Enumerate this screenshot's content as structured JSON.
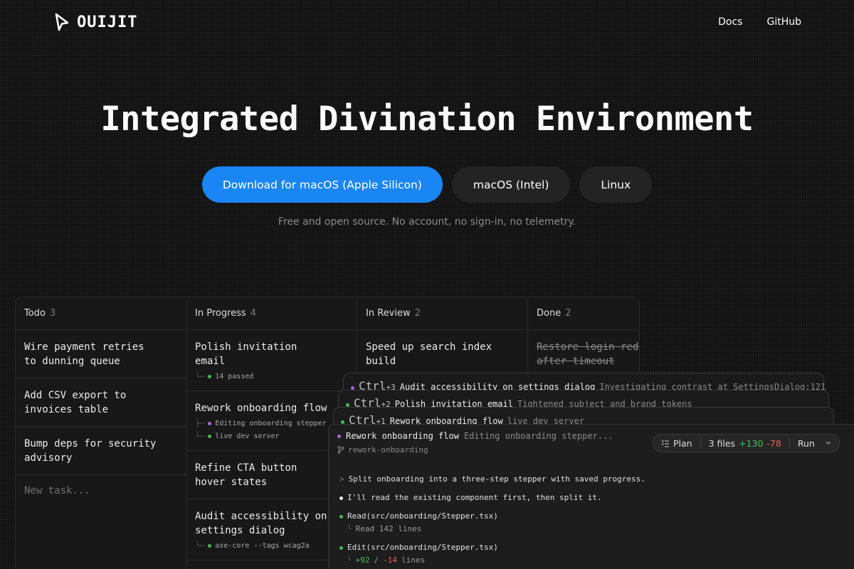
{
  "header": {
    "logo_text": "OUIJIT",
    "nav": [
      "Docs",
      "GitHub"
    ]
  },
  "hero": {
    "title": "Integrated Divination Environment",
    "buttons": {
      "primary": "Download for macOS (Apple Silicon)",
      "intel": "macOS (Intel)",
      "linux": "Linux"
    },
    "subtitle": "Free and open source. No account, no sign-in, no telemetry."
  },
  "board": {
    "columns": [
      {
        "name": "Todo",
        "count": "3"
      },
      {
        "name": "In Progress",
        "count": "4"
      },
      {
        "name": "In Review",
        "count": "2"
      },
      {
        "name": "Done",
        "count": "2"
      }
    ],
    "todo": {
      "cards": [
        "Wire payment retries\nto dunning queue",
        "Add CSV export to\ninvoices table",
        "Bump deps for security\nadvisory"
      ],
      "new_task_placeholder": "New task..."
    },
    "in_progress": {
      "card1_title": "Polish invitation\nemail",
      "card1_sub": "14 passed",
      "card2_title": "Rework onboarding flow",
      "card2_sub1": "Editing onboarding stepper",
      "card2_sub2": "live dev server",
      "card3_title": "Refine CTA button\nhover states",
      "card4_title": "Audit accessibility on\nsettings dialog",
      "card4_sub": "axe-core --tags wcag2a"
    },
    "in_review": {
      "card1_title": "Speed up search index\nbuild"
    },
    "done": {
      "card1_line1": "Restore login redirect",
      "card1_line2": "after timeout"
    }
  },
  "sessions": [
    {
      "key": "Ctrl",
      "num": "+3",
      "title": "Audit accessibility on settings dialog",
      "status": "Investigating contrast at SettingsDialog:121"
    },
    {
      "key": "Ctrl",
      "num": "+2",
      "title": "Polish invitation email",
      "status": "Tightened subject and brand tokens"
    },
    {
      "key": "Ctrl",
      "num": "+1",
      "title": "Rework onboarding flow",
      "status": "live dev server"
    }
  ],
  "active_session": {
    "title": "Rework onboarding flow",
    "status": "Editing onboarding stepper...",
    "branch": "rework-onboarding",
    "toolbar": {
      "plan": "Plan",
      "files": "3 files",
      "added": "+130",
      "removed": "-78",
      "run": "Run"
    },
    "log": {
      "prompt": "Split onboarding into a three-step stepper with saved progress.",
      "reply": "I'll read the existing component first, then split it.",
      "read_call": "Read(src/onboarding/Stepper.tsx)",
      "read_result": "Read 142 lines",
      "edit_call": "Edit(src/onboarding/Stepper.tsx)",
      "edit_added": "+92",
      "edit_sep": "/",
      "edit_removed": "-14",
      "edit_unit": "lines"
    }
  },
  "colors": {
    "accent": "#1a86f5",
    "success": "#3fbf4f",
    "working": "#a36bd6",
    "danger": "#e3605d"
  }
}
